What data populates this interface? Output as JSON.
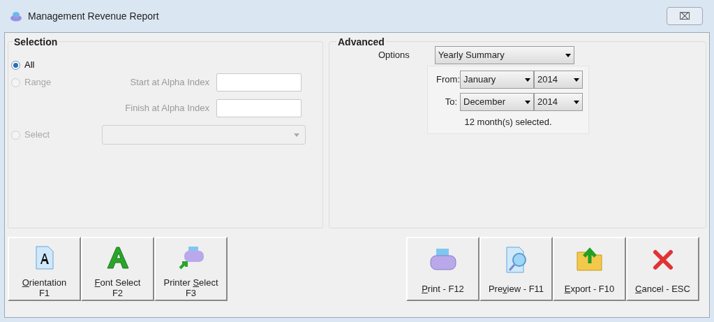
{
  "window": {
    "title": "Management Revenue Report",
    "close": "⌧"
  },
  "selection": {
    "title": "Selection",
    "radios": [
      {
        "label": "All",
        "selected": true,
        "disabled": false
      },
      {
        "label": "Range",
        "selected": false,
        "disabled": true
      },
      {
        "label": "Select",
        "selected": false,
        "disabled": true
      }
    ],
    "start_label": "Start at Alpha Index",
    "finish_label": "Finish at Alpha Index"
  },
  "advanced": {
    "title": "Advanced",
    "options_label": "Options",
    "options_value": "Yearly Summary",
    "from_label": "From:",
    "from_month": "January",
    "from_year": "2014",
    "to_label": "To:",
    "to_month": "December",
    "to_year": "2014",
    "summary": "12 month(s) selected."
  },
  "left_buttons": [
    {
      "kind": "orientation",
      "mnemonic": "O",
      "rest": "rientation",
      "key": "F1"
    },
    {
      "kind": "font",
      "mnemonic": "F",
      "rest": "ont Select",
      "key": "F2"
    },
    {
      "kind": "printer-select",
      "lead": "Printer ",
      "mnemonic": "S",
      "rest": "elect",
      "key": "F3"
    }
  ],
  "right_buttons": [
    {
      "kind": "print",
      "mnemonic": "P",
      "rest": "rint - F12"
    },
    {
      "kind": "preview",
      "lead": "Pre",
      "mnemonic": "v",
      "rest": "iew - F11"
    },
    {
      "kind": "export",
      "mnemonic": "E",
      "rest": "xport - F10"
    },
    {
      "kind": "cancel",
      "mnemonic": "C",
      "rest": "ancel - ESC"
    }
  ]
}
